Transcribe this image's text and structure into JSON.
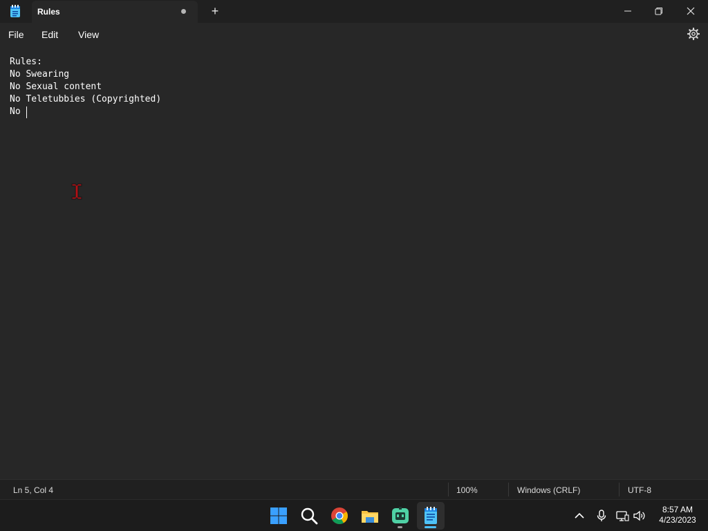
{
  "window": {
    "tab_title": "Rules",
    "unsaved_indicator": "•",
    "new_tab_label": "+",
    "minimize_label": "—",
    "maximize_label": "❐",
    "close_label": "✕"
  },
  "menu": {
    "file": "File",
    "edit": "Edit",
    "view": "View"
  },
  "editor": {
    "lines": [
      "Rules:",
      "No Swearing",
      "No Sexual content",
      "No Teletubbies (Copyrighted)",
      "No "
    ]
  },
  "status": {
    "position": "Ln 5, Col 4",
    "zoom": "100%",
    "line_ending": "Windows (CRLF)",
    "encoding": "UTF-8"
  },
  "taskbar": {
    "apps": [
      "start-icon",
      "search-icon",
      "chrome-icon",
      "file-explorer-icon",
      "robot-app-icon",
      "notepad-icon"
    ],
    "active_app": "notepad-icon",
    "time": "8:57 AM",
    "date": "4/23/2023"
  },
  "colors": {
    "background": "#272727",
    "titlebar": "#202020",
    "accent": "#4cc2ff"
  }
}
